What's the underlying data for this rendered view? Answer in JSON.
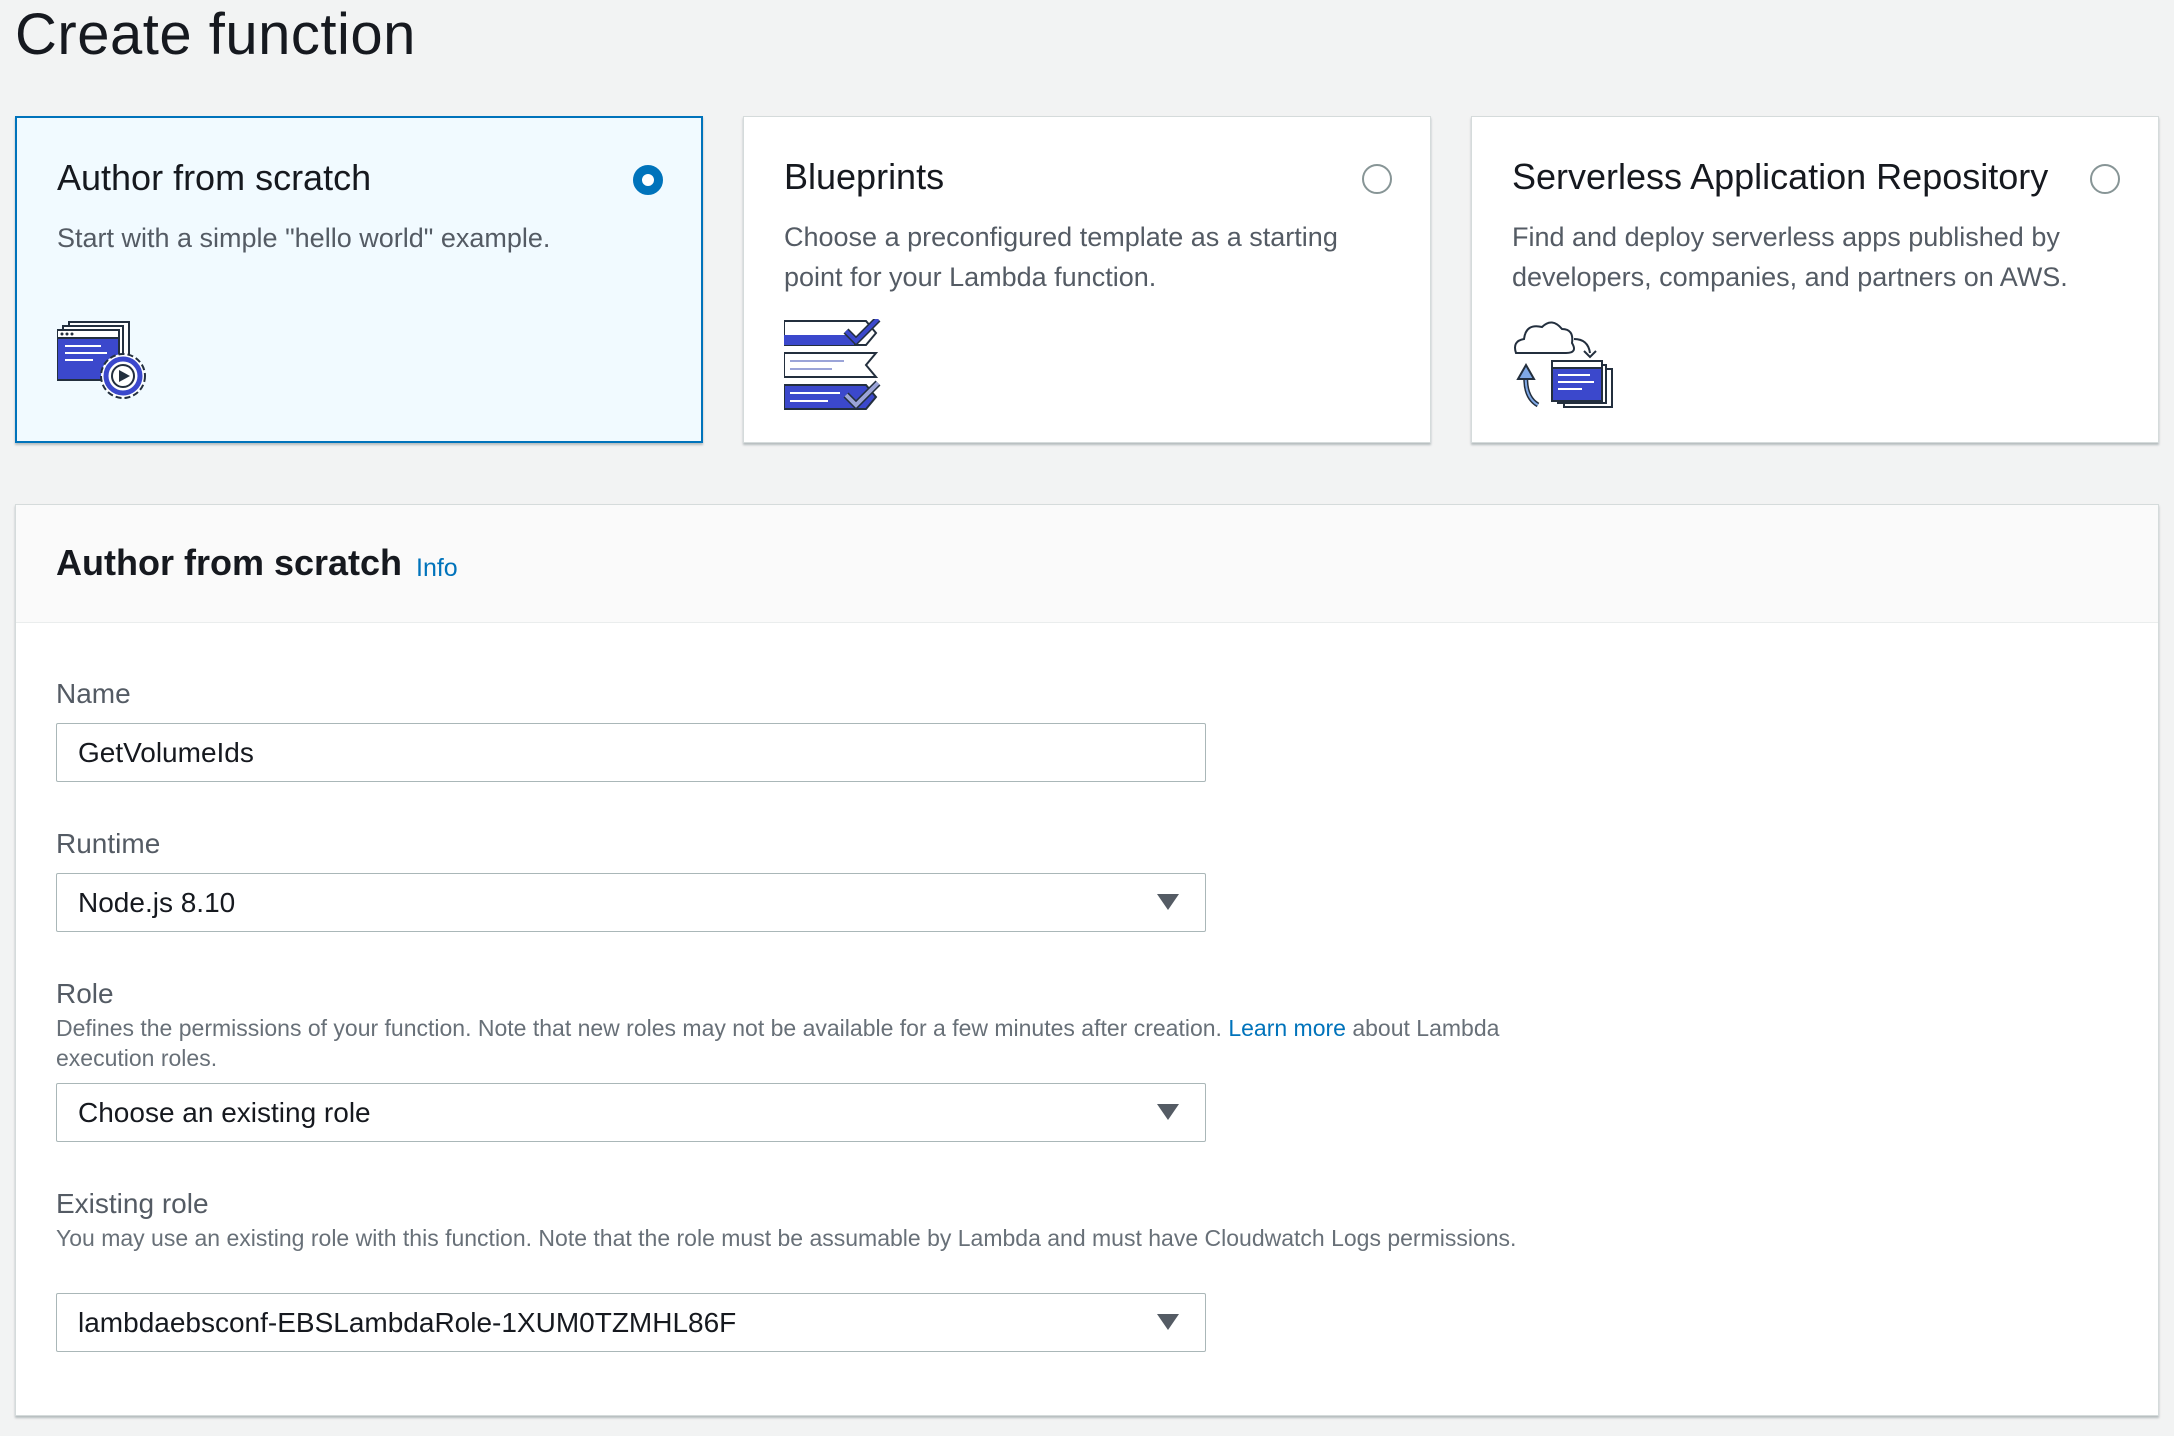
{
  "page": {
    "title": "Create function"
  },
  "options": [
    {
      "title": "Author from scratch",
      "description": "Start with a simple \"hello world\" example.",
      "selected": true,
      "icon": "code-gear-icon"
    },
    {
      "title": "Blueprints",
      "description": "Choose a preconfigured template as a starting point for your Lambda function.",
      "selected": false,
      "icon": "checklist-icon"
    },
    {
      "title": "Serverless Application Repository",
      "description": "Find and deploy serverless apps published by developers, companies, and partners on AWS.",
      "selected": false,
      "icon": "cloud-deploy-icon"
    }
  ],
  "form": {
    "title": "Author from scratch",
    "info_label": "Info",
    "name": {
      "label": "Name",
      "value": "GetVolumeIds"
    },
    "runtime": {
      "label": "Runtime",
      "value": "Node.js 8.10"
    },
    "role": {
      "label": "Role",
      "description_before": "Defines the permissions of your function. Note that new roles may not be available for a few minutes after creation. ",
      "learn_more": "Learn more",
      "description_after": " about Lambda execution roles.",
      "value": "Choose an existing role"
    },
    "existing_role": {
      "label": "Existing role",
      "description": "You may use an existing role with this function. Note that the role must be assumable by Lambda and must have Cloudwatch Logs permissions.",
      "value": "lambdaebsconf-EBSLambdaRole-1XUM0TZMHL86F"
    }
  },
  "colors": {
    "accent": "#0073bb",
    "selected_card_bg": "#f1faff",
    "icon_blue": "#3b48cc"
  }
}
